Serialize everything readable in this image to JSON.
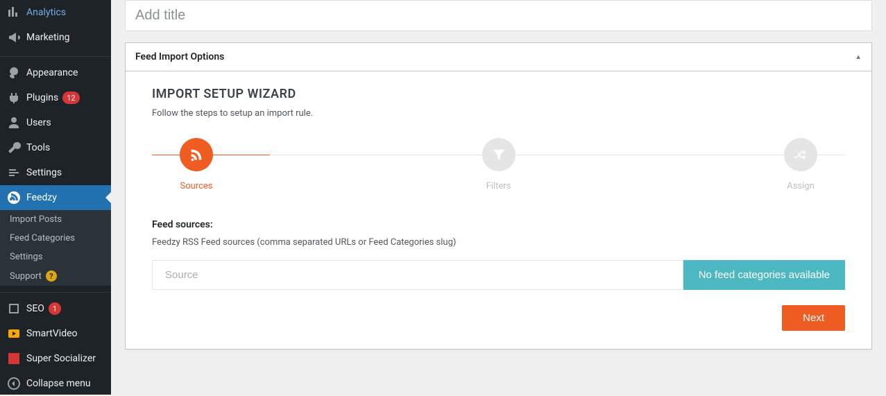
{
  "sidebar": {
    "items": [
      {
        "label": "Analytics"
      },
      {
        "label": "Marketing"
      }
    ],
    "items2": [
      {
        "label": "Appearance"
      },
      {
        "label": "Plugins",
        "badge": "12"
      },
      {
        "label": "Users"
      },
      {
        "label": "Tools"
      },
      {
        "label": "Settings"
      },
      {
        "label": "Feedzy"
      }
    ],
    "sub": [
      {
        "label": "Import Posts"
      },
      {
        "label": "Feed Categories"
      },
      {
        "label": "Settings"
      },
      {
        "label": "Support",
        "help": "?"
      }
    ],
    "items3": [
      {
        "label": "SEO",
        "badge": "1"
      },
      {
        "label": "SmartVideo"
      },
      {
        "label": "Super Socializer"
      },
      {
        "label": "Collapse menu"
      }
    ]
  },
  "title_placeholder": "Add title",
  "postbox": {
    "header": "Feed Import Options",
    "wizard_title": "IMPORT SETUP WIZARD",
    "wizard_desc": "Follow the steps to setup an import rule.",
    "steps": [
      {
        "label": "Sources"
      },
      {
        "label": "Filters"
      },
      {
        "label": "Assign"
      }
    ],
    "section_title": "Feed sources:",
    "section_desc": "Feedzy RSS Feed sources (comma separated URLs or Feed Categories slug)",
    "source_placeholder": "Source",
    "source_btn": "No feed categories available",
    "next_btn": "Next"
  }
}
